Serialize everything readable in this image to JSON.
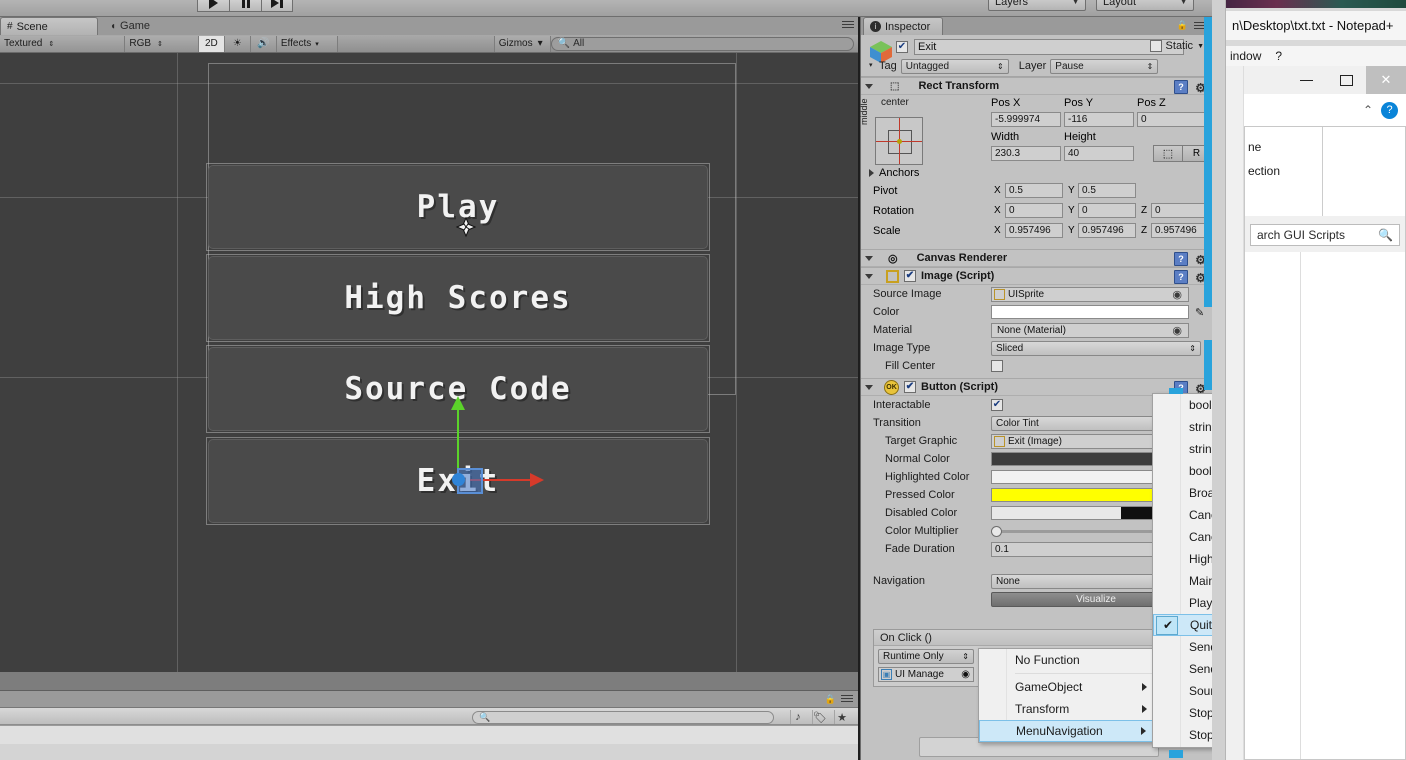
{
  "app": {
    "name": "Unity Editor"
  },
  "toolbar": {
    "play_label": "play-triangle",
    "pause_label": "pause",
    "step_label": "step",
    "layers": "Layers",
    "layout": "Layout"
  },
  "scene_panel": {
    "tabs": [
      {
        "label": "Scene",
        "icon": "grid-icon",
        "active": true
      },
      {
        "label": "Game",
        "icon": "gamepad-icon",
        "active": false
      }
    ],
    "toolbar": {
      "draw_mode": "Textured",
      "render_mode": "RGB",
      "view_2d": "2D",
      "lighting_icon": "sun-icon",
      "audio_icon": "speaker-icon",
      "effects": "Effects",
      "gizmos": "Gizmos",
      "search_value": "All",
      "search_icon": "search-icon"
    },
    "menu_buttons": [
      {
        "label": "Play"
      },
      {
        "label": "High Scores"
      },
      {
        "label": "Source Code"
      },
      {
        "label": "Exit"
      }
    ]
  },
  "project_bar": {
    "search_placeholder": "",
    "search_icon": "search-icon",
    "icons": [
      "filter-type-icon",
      "filter-label-icon",
      "favorite-star-icon"
    ]
  },
  "inspector": {
    "tab_label": "Inspector",
    "tab_icon": "info-icon",
    "lock_icon": "lock-icon",
    "menu_icon": "hamburger-icon",
    "gameobject": {
      "name": "Exit",
      "enabled": true,
      "static_label": "Static",
      "tag_label": "Tag",
      "tag_value": "Untagged",
      "layer_label": "Layer",
      "layer_value": "Pause",
      "icon": "cube-icon"
    },
    "rect_transform": {
      "title": "Rect Transform",
      "anchor_preset": "center",
      "anchor_preset_vertical": "middle",
      "fields": {
        "pos_x_label": "Pos X",
        "pos_x": "-5.999974",
        "pos_y_label": "Pos Y",
        "pos_y": "-116",
        "pos_z_label": "Pos Z",
        "pos_z": "0",
        "width_label": "Width",
        "width": "230.3",
        "height_label": "Height",
        "height": "40",
        "blueprint_icon": "blueprint-icon",
        "raw_label": "R",
        "anchors_label": "Anchors",
        "pivot_label": "Pivot",
        "pivot_x": "0.5",
        "pivot_y": "0.5",
        "rotation_label": "Rotation",
        "rot_x": "0",
        "rot_y": "0",
        "rot_z": "0",
        "scale_label": "Scale",
        "scale_x": "0.957496",
        "scale_y": "0.957496",
        "scale_z": "0.957496",
        "x": "X",
        "y": "Y",
        "z": "Z"
      }
    },
    "canvas_renderer": {
      "title": "Canvas Renderer",
      "icon": "target-icon"
    },
    "image_script": {
      "title": "Image (Script)",
      "enabled": true,
      "icon": "image-icon",
      "rows": [
        {
          "label": "Source Image",
          "value": "UISprite",
          "type": "object",
          "icon": "sprite-icon"
        },
        {
          "label": "Color",
          "value": "",
          "type": "color",
          "color": "#ffffff"
        },
        {
          "label": "Material",
          "value": "None (Material)",
          "type": "object"
        },
        {
          "label": "Image Type",
          "value": "Sliced",
          "type": "dropdown"
        },
        {
          "label": "Fill Center",
          "value": "",
          "type": "checkbox",
          "checked": false
        }
      ]
    },
    "button_script": {
      "title": "Button (Script)",
      "enabled": true,
      "icon": "ok-icon",
      "interactable_label": "Interactable",
      "interactable": true,
      "transition_label": "Transition",
      "transition_value": "Color Tint",
      "target_graphic_label": "Target Graphic",
      "target_graphic_value": "Exit (Image)",
      "normal_color_label": "Normal Color",
      "normal_color": "#3c3c3c",
      "highlighted_color_label": "Highlighted Color",
      "highlighted_color": "#f2f2f2",
      "pressed_color_label": "Pressed Color",
      "pressed_color": "#ffff00",
      "disabled_color_label": "Disabled Color",
      "disabled_color": "#e8e8e8",
      "color_multiplier_label": "Color Multiplier",
      "color_multiplier": "1",
      "fade_duration_label": "Fade Duration",
      "fade_duration": "0.1",
      "navigation_label": "Navigation",
      "navigation_value": "None",
      "visualize_label": "Visualize"
    },
    "on_click": {
      "title": "On Click ()",
      "mode": "Runtime Only",
      "function": "MenuNavigation.Quit",
      "object": "UI Manage",
      "object_icon": "script-icon"
    }
  },
  "context_menu": {
    "items": [
      {
        "label": "No Function",
        "submenu": false,
        "selected": false
      },
      {
        "label": "GameObject",
        "submenu": true,
        "selected": false
      },
      {
        "label": "Transform",
        "submenu": true,
        "selected": false
      },
      {
        "label": "MenuNavigation",
        "submenu": true,
        "selected": true
      }
    ]
  },
  "submenu": {
    "items": [
      {
        "label": "bool enabled",
        "checked": false
      },
      {
        "label": "string name",
        "checked": false
      },
      {
        "label": "string tag",
        "checked": false
      },
      {
        "label": "bool useGUILayout",
        "checked": false
      },
      {
        "label": "BroadcastMessage (string)",
        "checked": false
      },
      {
        "label": "CancelInvoke (string)",
        "checked": false
      },
      {
        "label": "CancelInvoke ()",
        "checked": false
      },
      {
        "label": "HighScores ()",
        "checked": false
      },
      {
        "label": "MainMenu ()",
        "checked": false
      },
      {
        "label": "Play ()",
        "checked": false
      },
      {
        "label": "Quit ()",
        "checked": true
      },
      {
        "label": "SendMessage (string)",
        "checked": false
      },
      {
        "label": "SendMessageUpwards (string)",
        "checked": false
      },
      {
        "label": "SourceCode ()",
        "checked": false
      },
      {
        "label": "StopAllCoroutines ()",
        "checked": false
      },
      {
        "label": "StopCoroutine (string)",
        "checked": false
      }
    ]
  },
  "notepad": {
    "title": "n\\Desktop\\txt.txt - Notepad+",
    "menu_window": "indow",
    "menu_help": "?",
    "minimize_icon": "minimize-icon",
    "maximize_icon": "maximize-icon",
    "close_icon": "close-icon",
    "chevron_icon": "chevron-up-icon",
    "help_icon": "help-circle-icon",
    "tree_items": [
      "ne",
      "ection"
    ],
    "search_value": "arch GUI Scripts",
    "search_icon": "search-icon"
  }
}
